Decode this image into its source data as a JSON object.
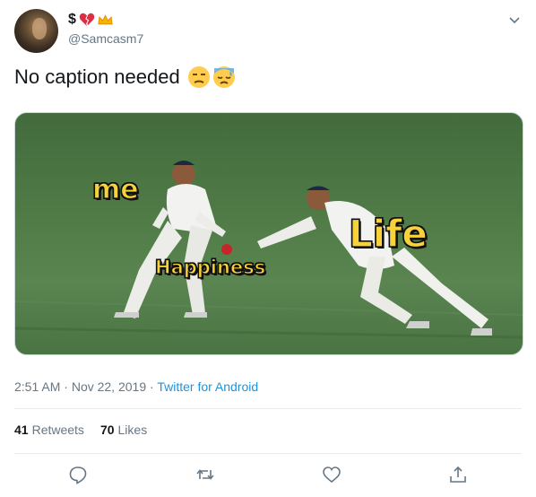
{
  "user": {
    "display_name": "$",
    "handle": "@Samcasm7",
    "name_emojis": [
      "broken-heart-icon",
      "crown-icon"
    ]
  },
  "tweet": {
    "text": "No caption needed",
    "emojis": [
      "unamused-face-icon",
      "downcast-sweat-face-icon"
    ],
    "meme_labels": {
      "me": "me",
      "life": "Life",
      "happiness": "Happiness"
    },
    "time": "2:51 AM",
    "date": "Nov 22, 2019",
    "dot": " · ",
    "sep": " · ",
    "source": "Twitter for Android"
  },
  "stats": {
    "retweets_count": "41",
    "retweets_label": "Retweets",
    "likes_count": "70",
    "likes_label": "Likes"
  },
  "actions": [
    "reply-icon",
    "retweet-icon",
    "like-icon",
    "share-icon"
  ],
  "colors": {
    "link": "#1b95e0",
    "secondary": "#657786",
    "meme_text": "#f7d23a"
  }
}
